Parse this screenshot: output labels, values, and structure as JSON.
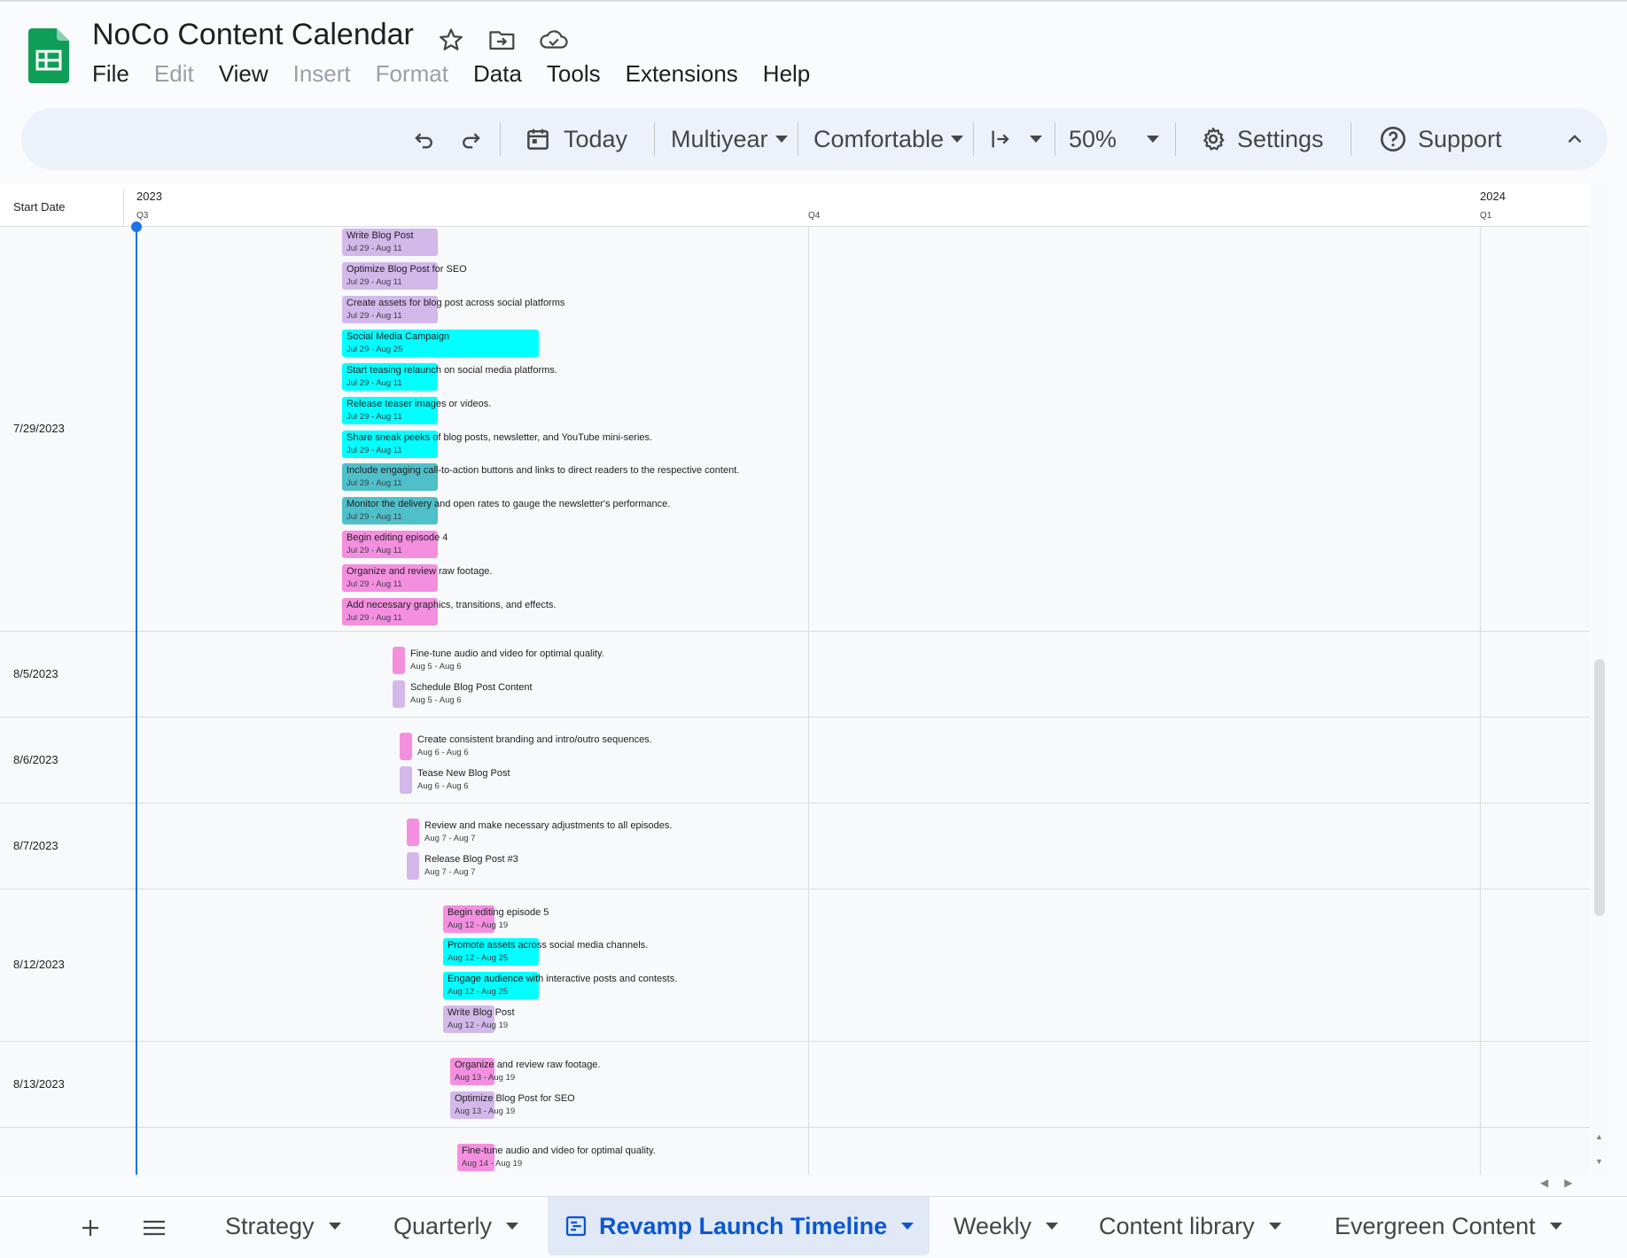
{
  "app": {
    "title": "NoCo Content Calendar",
    "title_icons": [
      "star-icon",
      "move-to-folder-icon",
      "cloud-saved-icon"
    ],
    "menu": [
      {
        "label": "File",
        "enabled": true
      },
      {
        "label": "Edit",
        "enabled": false
      },
      {
        "label": "View",
        "enabled": true
      },
      {
        "label": "Insert",
        "enabled": false
      },
      {
        "label": "Format",
        "enabled": false
      },
      {
        "label": "Data",
        "enabled": true
      },
      {
        "label": "Tools",
        "enabled": true
      },
      {
        "label": "Extensions",
        "enabled": true
      },
      {
        "label": "Help",
        "enabled": true
      }
    ]
  },
  "toolbar": {
    "today": "Today",
    "scale": "Multiyear",
    "density": "Comfortable",
    "zoom": "50%",
    "settings": "Settings",
    "support": "Support"
  },
  "timeline": {
    "header_label": "Start Date",
    "years": [
      {
        "label": "2023"
      },
      {
        "label": "2024"
      }
    ],
    "quarters": [
      {
        "label": "Q3"
      },
      {
        "label": "Q4"
      },
      {
        "label": "Q1"
      }
    ],
    "groups": [
      {
        "date": "7/29/2023"
      },
      {
        "date": "8/5/2023"
      },
      {
        "date": "8/6/2023"
      },
      {
        "date": "8/7/2023"
      },
      {
        "date": "8/12/2023"
      },
      {
        "date": "8/13/2023"
      }
    ],
    "colors": {
      "lavender": "#d3b8ea",
      "pink": "#f48fe0",
      "cyan": "#00ffff",
      "teal": "#4fbfc9",
      "today": "#1a73e8"
    },
    "tasks": [
      {
        "title": "Write Blog Post",
        "dates": "Jul 29 - Aug 11",
        "color": "lavender"
      },
      {
        "title": "Optimize Blog Post for SEO",
        "dates": "Jul 29 - Aug 11",
        "color": "lavender"
      },
      {
        "title": "Create assets for blog post across social platforms",
        "dates": "Jul 29 - Aug 11",
        "color": "lavender"
      },
      {
        "title": "Social Media Campaign",
        "dates": "Jul 29 - Aug 25",
        "color": "cyan"
      },
      {
        "title": "Start teasing relaunch on social media platforms.",
        "dates": "Jul 29 - Aug 11",
        "color": "cyan"
      },
      {
        "title": "Release teaser images or videos.",
        "dates": "Jul 29 - Aug 11",
        "color": "cyan"
      },
      {
        "title": "Share sneak peeks of blog posts, newsletter, and YouTube mini-series.",
        "dates": "Jul 29 - Aug 11",
        "color": "cyan"
      },
      {
        "title": "Include engaging call-to-action buttons and links to direct readers to the respective content.",
        "dates": "Jul 29 - Aug 11",
        "color": "teal"
      },
      {
        "title": "Monitor the delivery and open rates to gauge the newsletter's performance.",
        "dates": "Jul 29 - Aug 11",
        "color": "teal"
      },
      {
        "title": "Begin editing episode 4",
        "dates": "Jul 29 - Aug 11",
        "color": "pink"
      },
      {
        "title": "Organize and review raw footage.",
        "dates": "Jul 29 - Aug 11",
        "color": "pink"
      },
      {
        "title": "Add necessary graphics, transitions, and effects.",
        "dates": "Jul 29 - Aug 11",
        "color": "pink"
      },
      {
        "title": "Fine-tune audio and video for optimal quality.",
        "dates": "Aug 5 - Aug 6",
        "color": "pink"
      },
      {
        "title": "Schedule Blog Post Content",
        "dates": "Aug 5 - Aug 6",
        "color": "lavender"
      },
      {
        "title": "Create consistent branding and intro/outro sequences.",
        "dates": "Aug 6 - Aug 6",
        "color": "pink"
      },
      {
        "title": "Tease New Blog Post",
        "dates": "Aug 6 - Aug 6",
        "color": "lavender"
      },
      {
        "title": "Review and make necessary adjustments to all episodes.",
        "dates": "Aug 7 - Aug 7",
        "color": "pink"
      },
      {
        "title": "Release Blog Post #3",
        "dates": "Aug 7 - Aug 7",
        "color": "lavender"
      },
      {
        "title": "Begin editing episode 5",
        "dates": "Aug 12 - Aug 19",
        "color": "pink"
      },
      {
        "title": "Promote assets across social media channels.",
        "dates": "Aug 12 - Aug 25",
        "color": "cyan"
      },
      {
        "title": "Engage audience with interactive posts and contests.",
        "dates": "Aug 12 - Aug 25",
        "color": "cyan"
      },
      {
        "title": "Write Blog Post",
        "dates": "Aug 12 - Aug 19",
        "color": "lavender"
      },
      {
        "title": "Organize and review raw footage.",
        "dates": "Aug 13 - Aug 19",
        "color": "pink"
      },
      {
        "title": "Optimize Blog Post for SEO",
        "dates": "Aug 13 - Aug 19",
        "color": "lavender"
      },
      {
        "title": "Fine-tune audio and video for optimal quality.",
        "dates": "Aug 14 - Aug 19",
        "color": "pink"
      }
    ]
  },
  "sheets": {
    "tabs": [
      {
        "label": "Strategy",
        "active": false
      },
      {
        "label": "Quarterly",
        "active": false
      },
      {
        "label": "Revamp Launch Timeline",
        "active": true
      },
      {
        "label": "Weekly",
        "active": false
      },
      {
        "label": "Content library",
        "active": false
      },
      {
        "label": "Evergreen Content",
        "active": false
      }
    ]
  }
}
